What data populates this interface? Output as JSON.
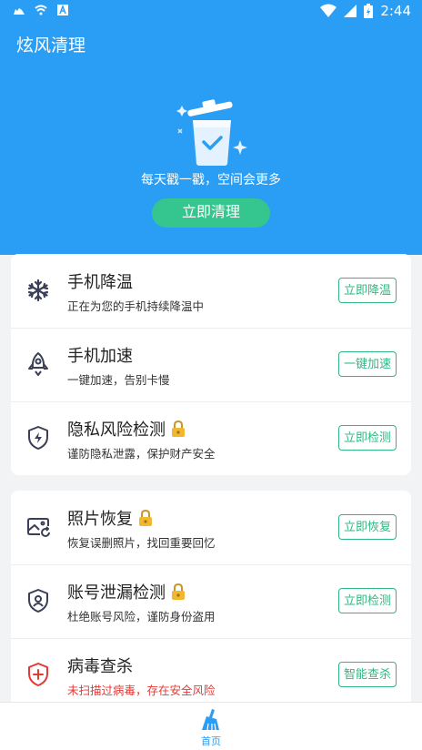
{
  "status_bar": {
    "time": "2:44"
  },
  "app": {
    "title": "炫风清理"
  },
  "hero": {
    "slogan": "每天戳一戳，空间会更多",
    "clean_button": "立即清理"
  },
  "features_top": [
    {
      "title": "手机降温",
      "subtitle": "正在为您的手机持续降温中",
      "action": "立即降温",
      "locked": false,
      "icon": "snowflake-icon"
    },
    {
      "title": "手机加速",
      "subtitle": "一键加速，告别卡慢",
      "action": "一键加速",
      "locked": false,
      "icon": "rocket-icon"
    },
    {
      "title": "隐私风险检测",
      "subtitle": "谨防隐私泄露，保护财产安全",
      "action": "立即检测",
      "locked": true,
      "icon": "shield-bolt-icon"
    }
  ],
  "features_bottom": [
    {
      "title": "照片恢复",
      "subtitle": "恢复误删照片，找回重要回忆",
      "action": "立即恢复",
      "locked": true,
      "icon": "photo-restore-icon"
    },
    {
      "title": "账号泄漏检测",
      "subtitle": "杜绝账号风险，谨防身份盗用",
      "action": "立即检测",
      "locked": true,
      "icon": "account-shield-icon"
    },
    {
      "title": "病毒查杀",
      "subtitle": "未扫描过病毒，存在安全风险",
      "action": "智能查杀",
      "locked": false,
      "icon": "virus-shield-icon"
    }
  ],
  "bottom_nav": {
    "home_label": "首页"
  },
  "colors": {
    "primary_blue": "#2a9ef4",
    "accent_green": "#2fb883",
    "danger_red": "#e53935"
  }
}
